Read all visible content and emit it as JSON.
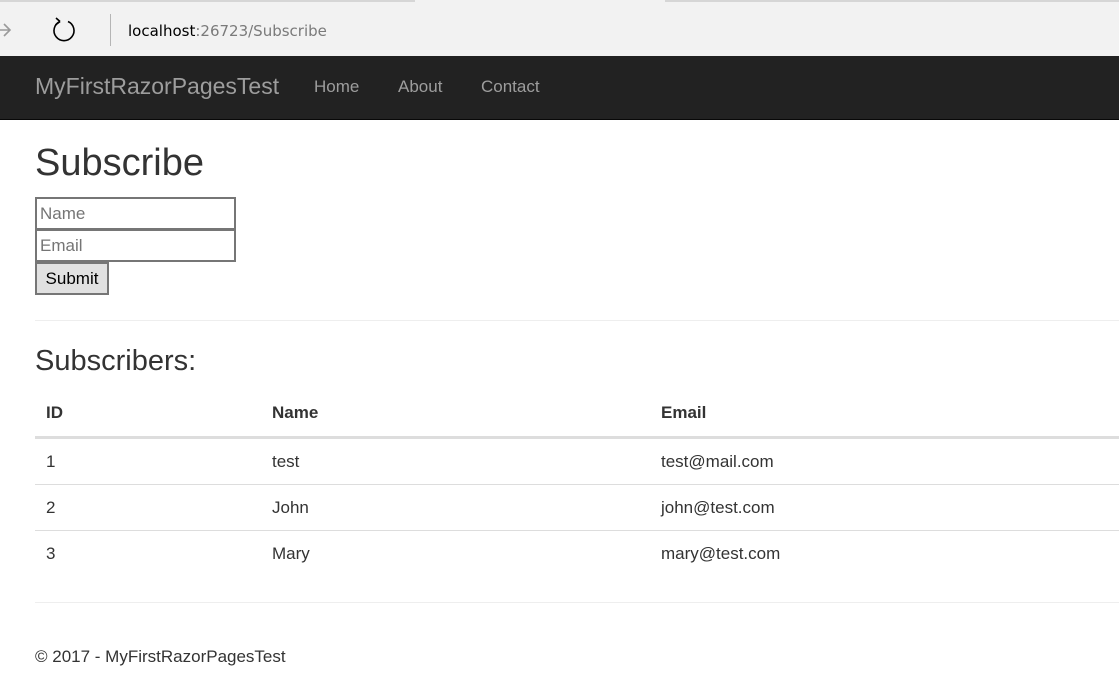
{
  "browser": {
    "address_host": "localhost",
    "address_path": ":26723/Subscribe"
  },
  "navbar": {
    "brand": "MyFirstRazorPagesTest",
    "links": [
      "Home",
      "About",
      "Contact"
    ]
  },
  "main": {
    "title": "Subscribe",
    "form": {
      "name_placeholder": "Name",
      "email_placeholder": "Email",
      "submit_label": "Submit"
    },
    "subscribers_heading": "Subscribers:",
    "table": {
      "columns": [
        "ID",
        "Name",
        "Email"
      ],
      "rows": [
        [
          "1",
          "test",
          "test@mail.com"
        ],
        [
          "2",
          "John",
          "john@test.com"
        ],
        [
          "3",
          "Mary",
          "mary@test.com"
        ]
      ]
    }
  },
  "footer": {
    "text": "© 2017 - MyFirstRazorPagesTest"
  },
  "icons": {
    "forward": "forward-arrow-icon",
    "refresh": "refresh-icon"
  },
  "colors": {
    "navbar_bg": "#222222",
    "nav_text": "#9d9d9d",
    "browser_bg": "#f2f2f2"
  }
}
